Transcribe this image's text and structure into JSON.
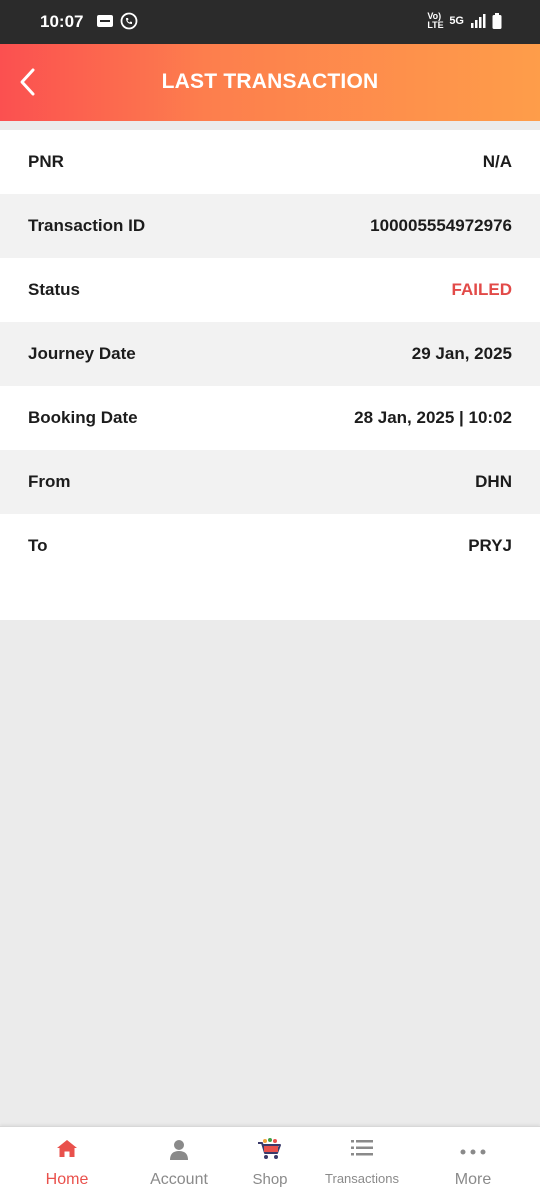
{
  "status_bar": {
    "time": "10:07",
    "network": "5G",
    "volte": "Vo) LTE"
  },
  "header": {
    "title": "LAST TRANSACTION"
  },
  "details": [
    {
      "label": "PNR",
      "value": "N/A"
    },
    {
      "label": "Transaction ID",
      "value": "100005554972976"
    },
    {
      "label": "Status",
      "value": "FAILED"
    },
    {
      "label": "Journey Date",
      "value": "29 Jan, 2025"
    },
    {
      "label": "Booking Date",
      "value": "28 Jan, 2025 | 10:02"
    },
    {
      "label": "From",
      "value": "DHN"
    },
    {
      "label": "To",
      "value": "PRYJ"
    }
  ],
  "nav": [
    {
      "label": "Home",
      "icon": "home-icon"
    },
    {
      "label": "Account",
      "icon": "account-icon"
    },
    {
      "label": "Shop",
      "icon": "shop-cart-icon"
    },
    {
      "label": "Transactions",
      "icon": "list-icon"
    },
    {
      "label": "More",
      "icon": "more-dots-icon"
    }
  ],
  "colors": {
    "accent": "#e9514c",
    "failed": "#e24a48",
    "header_gradient_start": "#fb5050",
    "header_gradient_end": "#fe9d4a"
  }
}
